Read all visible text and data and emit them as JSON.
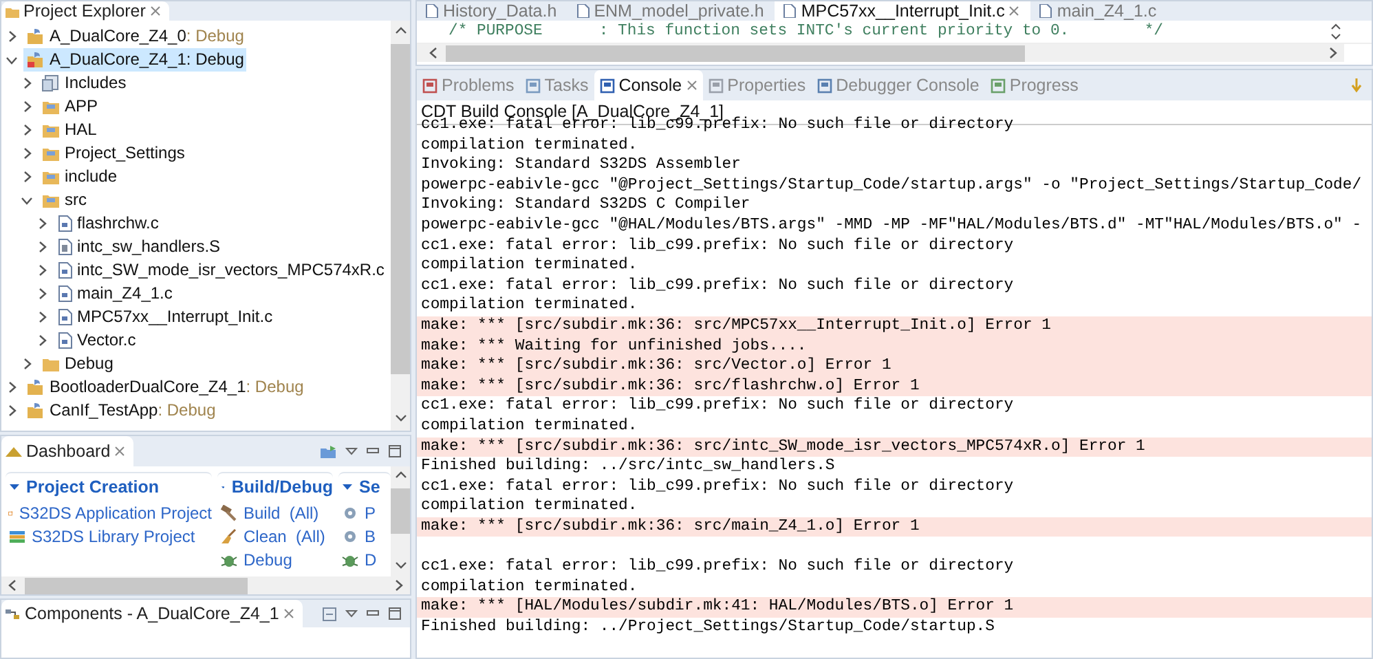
{
  "project_explorer": {
    "title": "Project Explorer",
    "tree": [
      {
        "label": "A_DualCore_Z4_0",
        "decoration": ": Debug",
        "kind": "project",
        "selected": false,
        "expanded": false
      },
      {
        "label": "A_DualCore_Z4_1",
        "decoration": ": Debug",
        "kind": "project-error",
        "selected": true,
        "expanded": true,
        "children": [
          {
            "label": "Includes",
            "kind": "includes",
            "selected": false,
            "expanded": false
          },
          {
            "label": "APP",
            "kind": "folder",
            "selected": false,
            "expanded": false
          },
          {
            "label": "HAL",
            "kind": "folder",
            "selected": false,
            "expanded": false
          },
          {
            "label": "Project_Settings",
            "kind": "folder",
            "selected": false,
            "expanded": false
          },
          {
            "label": "include",
            "kind": "folder",
            "selected": false,
            "expanded": false
          },
          {
            "label": "src",
            "kind": "folder",
            "selected": false,
            "expanded": true,
            "children": [
              {
                "label": "flashrchw.c",
                "kind": "c-file",
                "selected": false,
                "expanded": false
              },
              {
                "label": "intc_sw_handlers.S",
                "kind": "s-file",
                "selected": false,
                "expanded": false
              },
              {
                "label": "intc_SW_mode_isr_vectors_MPC574xR.c",
                "kind": "c-file",
                "selected": false,
                "expanded": false
              },
              {
                "label": "main_Z4_1.c",
                "kind": "c-file",
                "selected": false,
                "expanded": false
              },
              {
                "label": "MPC57xx__Interrupt_Init.c",
                "kind": "c-file",
                "selected": false,
                "expanded": false
              },
              {
                "label": "Vector.c",
                "kind": "c-file",
                "selected": false,
                "expanded": false
              }
            ]
          },
          {
            "label": "Debug",
            "kind": "plain-folder",
            "selected": false,
            "expanded": false
          }
        ]
      },
      {
        "label": "BootloaderDualCore_Z4_1",
        "decoration": ": Debug",
        "kind": "project",
        "selected": false,
        "expanded": false
      },
      {
        "label": "CanIf_TestApp",
        "decoration": ": Debug",
        "kind": "project",
        "selected": false,
        "expanded": false
      }
    ]
  },
  "dashboard": {
    "title": "Dashboard",
    "sections": [
      {
        "title": "Project Creation",
        "items": [
          {
            "label": "S32DS Application Project",
            "kind": "new-app"
          },
          {
            "label": "S32DS Library Project",
            "kind": "library"
          }
        ]
      },
      {
        "title": "Build/Debug",
        "items": [
          {
            "label": "Build  (All)",
            "kind": "build"
          },
          {
            "label": "Clean  (All)",
            "kind": "clean"
          },
          {
            "label": "Debug",
            "kind": "debug"
          }
        ]
      },
      {
        "title": "Se",
        "items": [
          {
            "label": "P",
            "kind": "settings"
          },
          {
            "label": "B",
            "kind": "settings"
          },
          {
            "label": "D",
            "kind": "debug"
          }
        ]
      }
    ]
  },
  "components": {
    "title": "Components - A_DualCore_Z4_1"
  },
  "editor": {
    "tabs": [
      {
        "label": "History_Data.h",
        "selected": false
      },
      {
        "label": "ENM_model_private.h",
        "selected": false
      },
      {
        "label": "MPC57xx__Interrupt_Init.c",
        "selected": true
      },
      {
        "label": "main_Z4_1.c",
        "selected": false
      }
    ],
    "code_line": "/* PURPOSE      : This function sets INTC's current priority to 0.        */"
  },
  "console": {
    "tabs": [
      {
        "label": "Problems",
        "selected": false
      },
      {
        "label": "Tasks",
        "selected": false
      },
      {
        "label": "Console",
        "selected": true
      },
      {
        "label": "Properties",
        "selected": false
      },
      {
        "label": "Debugger Console",
        "selected": false
      },
      {
        "label": "Progress",
        "selected": false
      }
    ],
    "title": "CDT Build Console [A_DualCore_Z4_1]",
    "lines": [
      {
        "text": "cc1.exe: fatal error: lib_c99.prefix: No such file or directory",
        "kind": "info"
      },
      {
        "text": "compilation terminated.",
        "kind": "info"
      },
      {
        "text": "Invoking: Standard S32DS Assembler",
        "kind": "info"
      },
      {
        "text": "powerpc-eabivle-gcc \"@Project_Settings/Startup_Code/startup.args\" -o \"Project_Settings/Startup_Code/",
        "kind": "info"
      },
      {
        "text": "Invoking: Standard S32DS C Compiler",
        "kind": "info"
      },
      {
        "text": "powerpc-eabivle-gcc \"@HAL/Modules/BTS.args\" -MMD -MP -MF\"HAL/Modules/BTS.d\" -MT\"HAL/Modules/BTS.o\" -",
        "kind": "info"
      },
      {
        "text": "cc1.exe: fatal error: lib_c99.prefix: No such file or directory",
        "kind": "info"
      },
      {
        "text": "compilation terminated.",
        "kind": "info"
      },
      {
        "text": "cc1.exe: fatal error: lib_c99.prefix: No such file or directory",
        "kind": "info"
      },
      {
        "text": "compilation terminated.",
        "kind": "info"
      },
      {
        "text": "make: *** [src/subdir.mk:36: src/MPC57xx__Interrupt_Init.o] Error 1",
        "kind": "error"
      },
      {
        "text": "make: *** Waiting for unfinished jobs....",
        "kind": "error"
      },
      {
        "text": "make: *** [src/subdir.mk:36: src/Vector.o] Error 1",
        "kind": "error"
      },
      {
        "text": "make: *** [src/subdir.mk:36: src/flashrchw.o] Error 1",
        "kind": "error"
      },
      {
        "text": "cc1.exe: fatal error: lib_c99.prefix: No such file or directory",
        "kind": "info"
      },
      {
        "text": "compilation terminated.",
        "kind": "info"
      },
      {
        "text": "make: *** [src/subdir.mk:36: src/intc_SW_mode_isr_vectors_MPC574xR.o] Error 1",
        "kind": "error"
      },
      {
        "text": "Finished building: ../src/intc_sw_handlers.S",
        "kind": "info"
      },
      {
        "text": "cc1.exe: fatal error: lib_c99.prefix: No such file or directory",
        "kind": "info"
      },
      {
        "text": "compilation terminated.",
        "kind": "info"
      },
      {
        "text": "make: *** [src/subdir.mk:36: src/main_Z4_1.o] Error 1",
        "kind": "error"
      },
      {
        "kind": "blank"
      },
      {
        "text": "cc1.exe: fatal error: lib_c99.prefix: No such file or directory",
        "kind": "info"
      },
      {
        "text": "compilation terminated.",
        "kind": "info"
      },
      {
        "text": "make: *** [HAL/Modules/subdir.mk:41: HAL/Modules/BTS.o] Error 1",
        "kind": "error"
      },
      {
        "text": "Finished building: ../Project_Settings/Startup_Code/startup.S",
        "kind": "info"
      }
    ]
  }
}
